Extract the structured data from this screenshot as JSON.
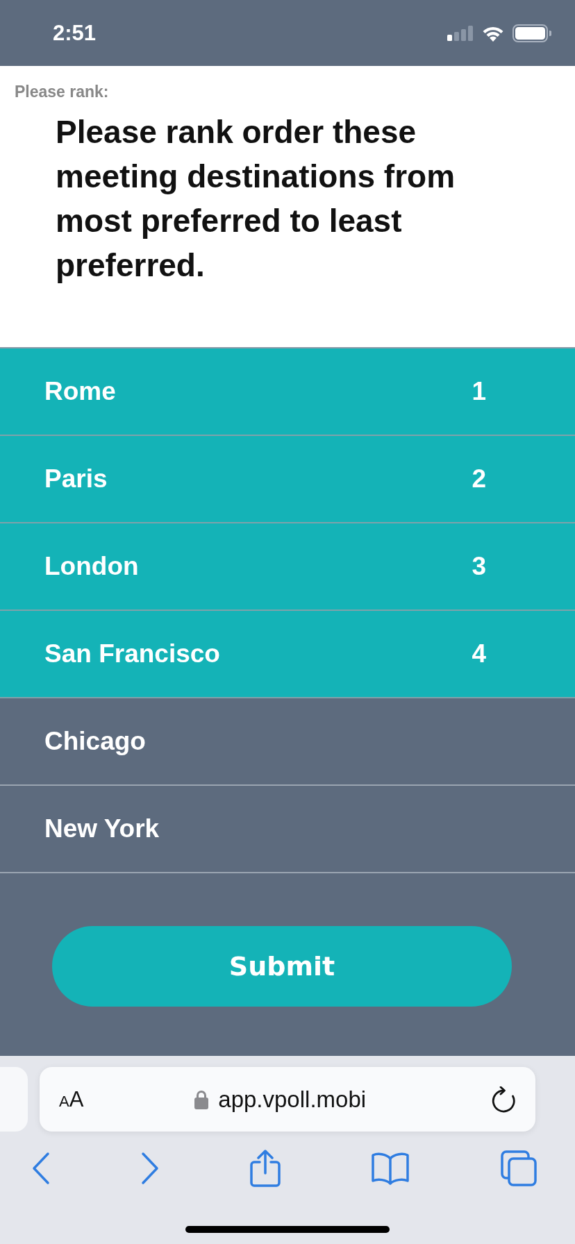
{
  "status_bar": {
    "time": "2:51"
  },
  "question": {
    "label": "Please rank:",
    "text": "Please rank order these meeting destinations from most preferred to least preferred."
  },
  "options": [
    {
      "name": "Rome",
      "rank": "1",
      "selected": true
    },
    {
      "name": "Paris",
      "rank": "2",
      "selected": true
    },
    {
      "name": "London",
      "rank": "3",
      "selected": true
    },
    {
      "name": "San Francisco",
      "rank": "4",
      "selected": true
    },
    {
      "name": "Chicago",
      "selected": false
    },
    {
      "name": "New York",
      "selected": false
    }
  ],
  "submit_button": "Submit",
  "browser": {
    "text_size_button": {
      "small": "A",
      "large": "A"
    },
    "url": "app.vpoll.mobi"
  }
}
